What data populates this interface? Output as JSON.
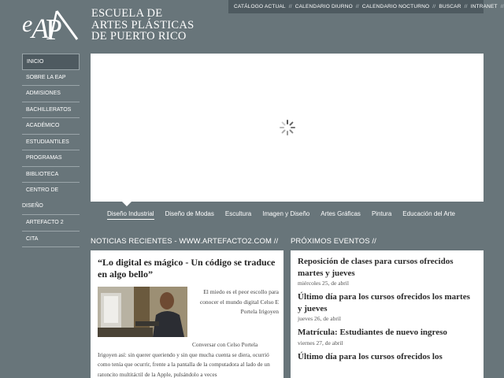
{
  "brand": {
    "logo_text": "eAP",
    "name_lines": [
      "ESCUELA DE",
      "ARTES PLÁSTICAS",
      "DE PUERTO RICO"
    ]
  },
  "topnav": {
    "items": [
      "CATÁLOGO ACTUAL",
      "CALENDARIO DIURNO",
      "CALENDARIO NOCTURNO",
      "BUSCAR",
      "INTRANET"
    ],
    "separator": "//"
  },
  "sidebar": {
    "items": [
      {
        "label": "INICIO",
        "active": true
      },
      {
        "label": "SOBRE LA EAP"
      },
      {
        "label": "ADMISIONES"
      },
      {
        "label": "BACHILLERATOS"
      },
      {
        "label": "ACADÉMICO"
      },
      {
        "label": "ESTUDIANTILES"
      },
      {
        "label": "PROGRAMAS"
      },
      {
        "label": "BIBLIOTECA"
      },
      {
        "label": "CENTRO DE",
        "label2": "DISEÑO"
      },
      {
        "label": "ARTEFACTO 2"
      },
      {
        "label": "CITA"
      }
    ]
  },
  "slider": {
    "tabs": [
      "Diseño Industrial",
      "Diseño de Modas",
      "Escultura",
      "Imagen y Diseño",
      "Artes Gráficas",
      "Pintura",
      "Educación del Arte"
    ],
    "active_tab": "Diseño Industrial"
  },
  "news": {
    "heading": "NOTICIAS RECIENTES - WWW.ARTEFACTO2.COM //",
    "title": "“Lo digital es mágico - Un código se traduce en algo bello”",
    "teaser": "El miedo es el peor escollo para conocer el mundo digital Celso E Portela Irigoyen",
    "body_lead": "Conversar con Celso Portela",
    "body": "Irigoyen así: sin querer queriendo y sin que mucha cuenta se diera, ocurrió como tenía que ocurrir, frente a la pantalla de la computadora al lado de un ratoncito multitáctil de la Apple, pulsándolo a veces"
  },
  "events": {
    "heading": "PRÓXIMOS EVENTOS //",
    "items": [
      {
        "title": "Reposición de clases para cursos ofrecidos martes y jueves",
        "date": "miércoles 25, de abril"
      },
      {
        "title": "Último día para los cursos ofrecidos los martes y jueves",
        "date": "jueves 26, de abril"
      },
      {
        "title": "Matrícula: Estudiantes de nuevo ingreso",
        "date": "viernes 27, de abril"
      },
      {
        "title": "Último día para los cursos ofrecidos los",
        "date": ""
      }
    ]
  },
  "colors": {
    "background": "#68757a",
    "nav_bar": "#4e5a60",
    "card": "#ffffff"
  }
}
